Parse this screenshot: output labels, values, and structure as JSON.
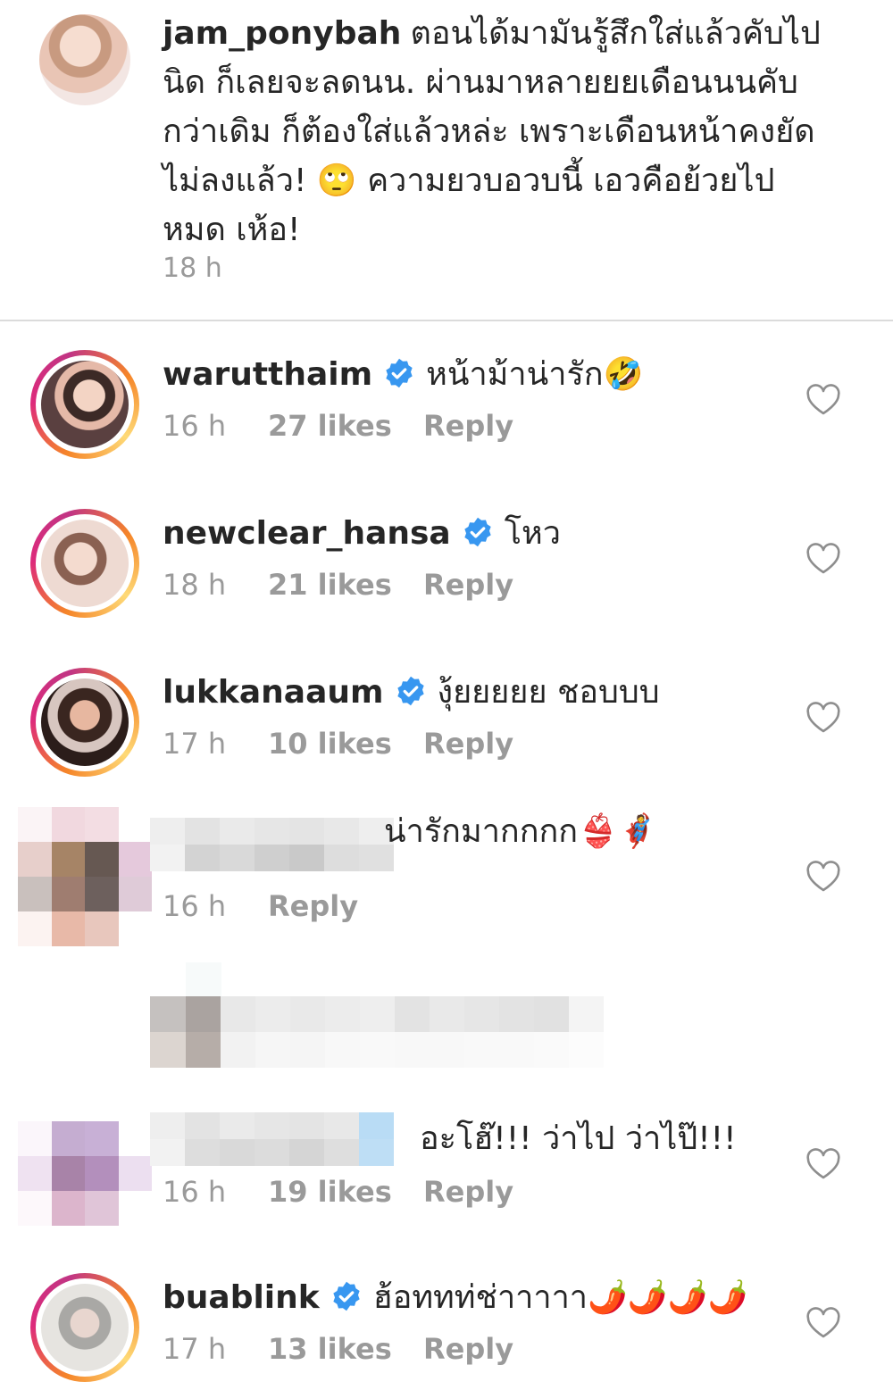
{
  "caption": {
    "username": "jam_ponybah",
    "text": "ตอนได้มามันรู้สึกใส่แล้วคับไปนิด ก็เลยจะลดนน. ผ่านมาหลายยยเดือนนนคับกว่าเดิม ก็ต้องใส่แล้วหล่ะ เพราะเดือนหน้าคงยัดไม่ลงแล้ว! 🙄 ความยวบอวบนี้ เอวคือย้วยไปหมด เห้อ!",
    "time": "18 h"
  },
  "comments": [
    {
      "username": "warutthaim",
      "text": "หน้าม้าน่ารัก🤣",
      "time": "16 h",
      "likes": "27 likes",
      "reply": "Reply"
    },
    {
      "username": "newclear_hansa",
      "text": "โหว",
      "time": "18 h",
      "likes": "21 likes",
      "reply": "Reply"
    },
    {
      "username": "lukkanaaum",
      "text": "งุ้ยยยยย ชอบบบ",
      "time": "17 h",
      "likes": "10 likes",
      "reply": "Reply"
    },
    {
      "username": "",
      "text": "น่ารักมากกกก👙🦸",
      "time": "16 h",
      "likes": "",
      "reply": "Reply"
    },
    {
      "username": "",
      "text": "อะโฮ๊!!! ว่าไป ว่าไป๊!!!",
      "time": "16 h",
      "likes": "19 likes",
      "reply": "Reply"
    },
    {
      "username": "buablink",
      "text": "ฮ้อททท่ช่าาาาา🌶️🌶️🌶️🌶️",
      "time": "17 h",
      "likes": "13 likes",
      "reply": "Reply"
    }
  ],
  "icons": {
    "verified": "verified-badge-icon",
    "heart": "heart-outline-icon"
  },
  "colors": {
    "verified_blue": "#3897f0",
    "muted_text": "#9a9a9a",
    "primary_text": "#262626"
  }
}
